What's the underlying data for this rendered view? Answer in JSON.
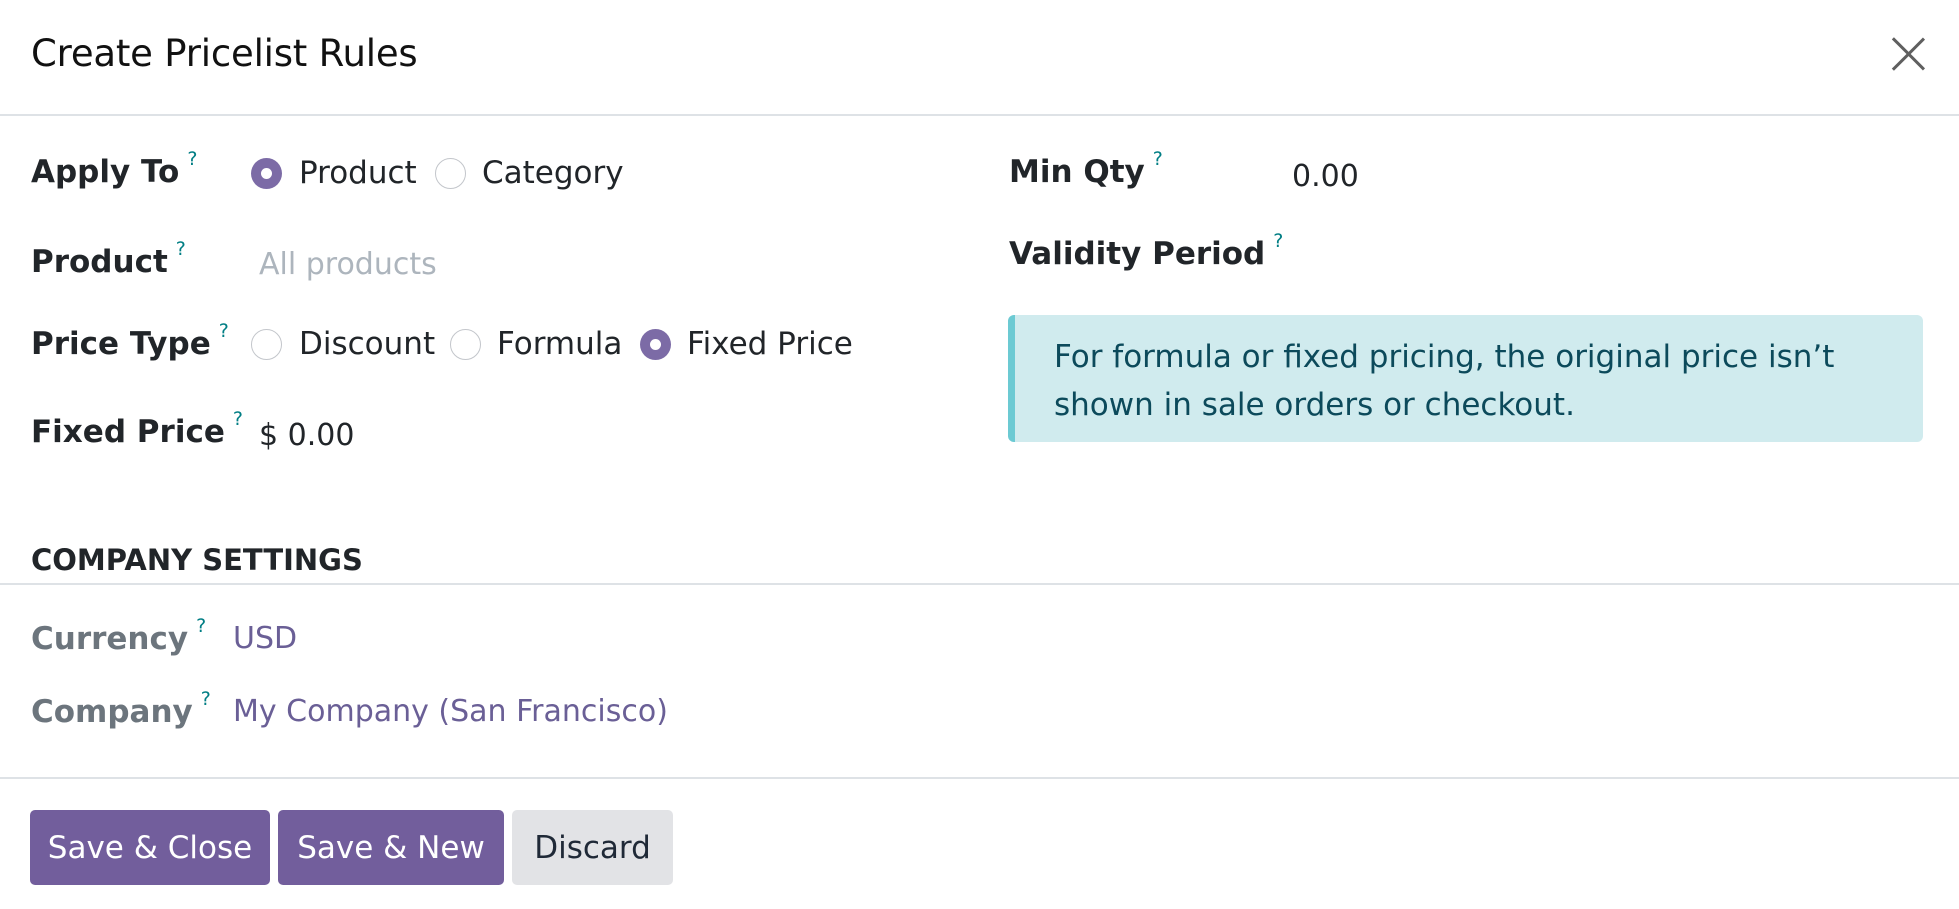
{
  "dialog": {
    "title": "Create Pricelist Rules"
  },
  "form": {
    "apply_to": {
      "label": "Apply To",
      "help": "?",
      "options": [
        "Product",
        "Category"
      ],
      "selected": "Product"
    },
    "product": {
      "label": "Product",
      "help": "?",
      "placeholder": "All products"
    },
    "price_type": {
      "label": "Price Type",
      "help": "?",
      "options": [
        "Discount",
        "Formula",
        "Fixed Price"
      ],
      "selected": "Fixed Price"
    },
    "fixed_price": {
      "label": "Fixed Price",
      "help": "?",
      "value": "$ 0.00"
    },
    "min_qty": {
      "label": "Min Qty",
      "help": "?",
      "value": "0.00"
    },
    "validity_period": {
      "label": "Validity Period",
      "help": "?"
    },
    "alert": {
      "text_line1": "For formula or fixed pricing, the original price isn’t",
      "text_line2": "shown in sale orders or checkout."
    }
  },
  "company_settings": {
    "heading": "COMPANY SETTINGS",
    "currency": {
      "label": "Currency",
      "help": "?",
      "value": "USD"
    },
    "company": {
      "label": "Company",
      "help": "?",
      "value": "My Company (San Francisco)"
    }
  },
  "footer": {
    "save_close": "Save & Close",
    "save_new": "Save & New",
    "discard": "Discard"
  },
  "colors": {
    "primary": "#725e9c",
    "help": "#017e84",
    "alert_bg": "#d0ebee",
    "link": "#6a5f96"
  }
}
